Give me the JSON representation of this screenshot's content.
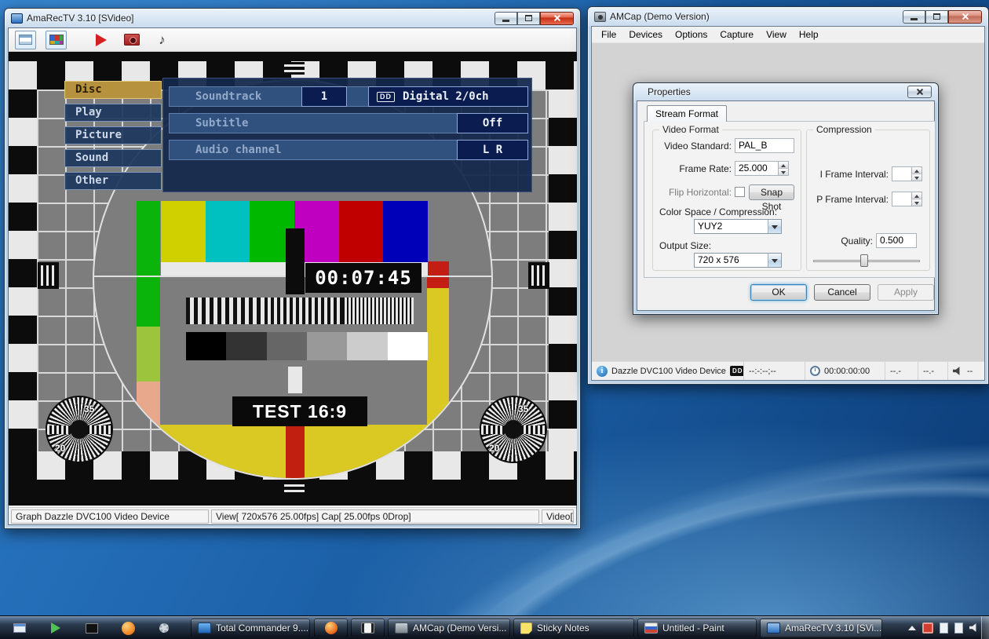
{
  "icons": {
    "note": "♪",
    "dd": "DD"
  },
  "amarectv": {
    "title": "AmaRecTV 3.10  [SVideo]",
    "status_left": "Graph Dazzle DVC100 Video Device",
    "status_center": "View[ 720x576 25.00fps]  Cap[ 25.00fps 0Drop]",
    "status_right": "Video[",
    "testcard": {
      "timecode": "00:07:45",
      "label": "TEST 16:9",
      "burst_top": "35",
      "burst_bottom": "20"
    },
    "dvd_menu": {
      "items": [
        "Disc",
        "Play",
        "Picture",
        "Sound",
        "Other"
      ],
      "soundtrack_label": "Soundtrack",
      "soundtrack_value": "1",
      "soundtrack_format": "Digital 2/0ch",
      "subtitle_label": "Subtitle",
      "subtitle_value": "Off",
      "audio_label": "Audio channel",
      "audio_value": "L R"
    }
  },
  "amcap": {
    "title": "AMCap (Demo Version)",
    "menu": [
      "File",
      "Devices",
      "Options",
      "Capture",
      "View",
      "Help"
    ],
    "status": {
      "device": "Dazzle DVC100 Video Device",
      "timecode": "--:-:--;--",
      "timer": "00:00:00:00",
      "val1": "--.-",
      "val2": "--.-",
      "volume": "--"
    }
  },
  "properties": {
    "title": "Properties",
    "tab": "Stream Format",
    "video_format_group": "Video Format",
    "video_standard_label": "Video Standard:",
    "video_standard_value": "PAL_B",
    "frame_rate_label": "Frame Rate:",
    "frame_rate_value": "25.000",
    "flip_horizontal_label": "Flip Horizontal:",
    "snap_shot_label": "Snap Shot",
    "color_space_label": "Color Space / Compression:",
    "color_space_value": "YUY2",
    "output_size_label": "Output Size:",
    "output_size_value": "720 x 576",
    "compression_group": "Compression",
    "i_frame_label": "I Frame Interval:",
    "p_frame_label": "P Frame Interval:",
    "quality_label": "Quality:",
    "quality_value": "0.500",
    "ok": "OK",
    "cancel": "Cancel",
    "apply": "Apply"
  },
  "taskbar": {
    "total_commander": "Total Commander 9....",
    "amcap": "AMCap (Demo Versi...",
    "sticky_notes": "Sticky Notes",
    "paint": "Untitled - Paint",
    "amarectv": "AmaRecTV 3.10  [SVi..."
  }
}
